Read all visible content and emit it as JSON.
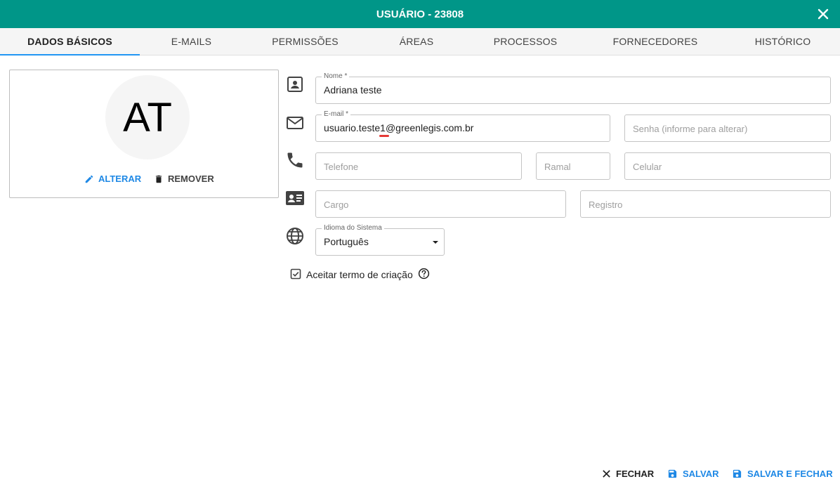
{
  "dialog": {
    "title": "USUÁRIO - 23808"
  },
  "tabs": [
    {
      "label": "DADOS BÁSICOS",
      "active": true
    },
    {
      "label": "E-MAILS"
    },
    {
      "label": "PERMISSÕES"
    },
    {
      "label": "ÁREAS"
    },
    {
      "label": "PROCESSOS"
    },
    {
      "label": "FORNECEDORES"
    },
    {
      "label": "HISTÓRICO"
    }
  ],
  "avatar": {
    "initials": "AT",
    "change_label": "ALTERAR",
    "remove_label": "REMOVER"
  },
  "form": {
    "name": {
      "label": "Nome *",
      "value": "Adriana teste"
    },
    "email": {
      "label": "E-mail *",
      "value": "usuario.teste1@greenlegis.com.br"
    },
    "password": {
      "placeholder": "Senha (informe para alterar)"
    },
    "phone": {
      "placeholder": "Telefone"
    },
    "extension": {
      "placeholder": "Ramal"
    },
    "mobile": {
      "placeholder": "Celular"
    },
    "position": {
      "placeholder": "Cargo"
    },
    "registry": {
      "placeholder": "Registro"
    },
    "language": {
      "label": "Idioma do Sistema",
      "value": "Português"
    },
    "terms": {
      "label": "Aceitar termo de criação",
      "checked": true
    }
  },
  "footer": {
    "close_label": "FECHAR",
    "save_label": "SALVAR",
    "save_close_label": "SALVAR E FECHAR"
  },
  "colors": {
    "primary": "#009688",
    "accent": "#1e88e5",
    "tab_indicator": "#2196f3"
  }
}
